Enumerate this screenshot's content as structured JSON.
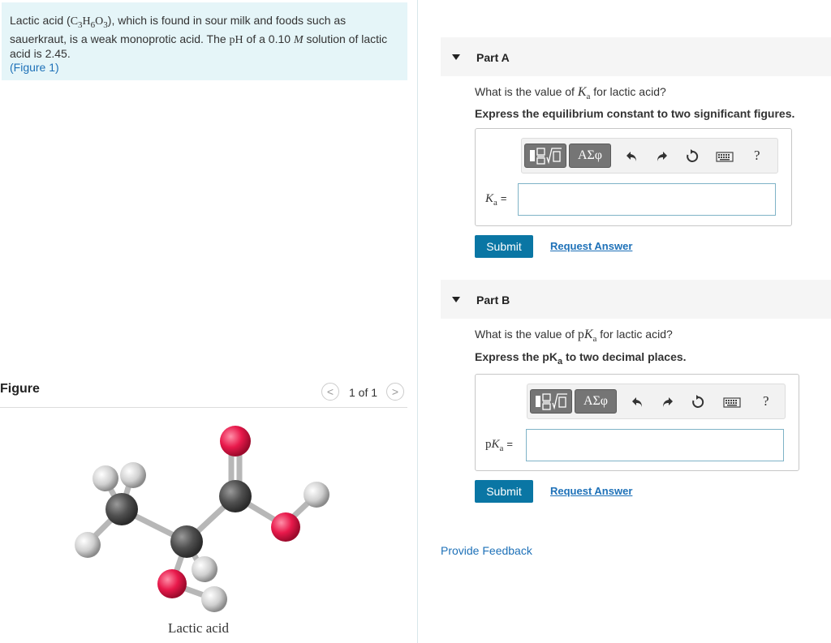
{
  "problem": {
    "text_1": "Lactic acid (",
    "formula_c": "C",
    "formula_c_sub": "3",
    "formula_h": "H",
    "formula_h_sub": "6",
    "formula_o": "O",
    "formula_o_sub": "3",
    "text_2": "), which is found in sour milk and foods such as sauerkraut, is a weak monoprotic acid. The ",
    "ph_symbol": "pH",
    "text_3": " of a 0.10 ",
    "molar_symbol": "M",
    "text_4": " solution of lactic acid is 2.45.",
    "figure_link": "(Figure 1)"
  },
  "figure": {
    "title": "Figure",
    "prev_icon": "chevron-left-icon",
    "prev_symbol": "<",
    "page_count": "1 of 1",
    "next_icon": "chevron-right-icon",
    "next_symbol": ">",
    "caption": "Lactic acid"
  },
  "partA": {
    "title": "Part A",
    "question_pre": "What is the value of ",
    "k_symbol": "K",
    "k_sub": "a",
    "question_post": " for lactic acid?",
    "instruction": "Express the equilibrium constant to two significant figures.",
    "label_k": "K",
    "label_sub": "a",
    "label_eq": "=",
    "input_value": "",
    "submit_label": "Submit",
    "request_label": "Request Answer"
  },
  "partB": {
    "title": "Part B",
    "question_pre": "What is the value of ",
    "pk_p": "p",
    "pk_k": "K",
    "pk_sub": "a",
    "question_post": " for lactic acid?",
    "instruction_pre": "Express the pK",
    "instruction_sub": "a",
    "instruction_post": " to two decimal places.",
    "label_p": "p",
    "label_k": "K",
    "label_sub": "a",
    "label_eq": "=",
    "input_value": "",
    "submit_label": "Submit",
    "request_label": "Request Answer"
  },
  "toolbar": {
    "greek_label": "ΑΣφ",
    "help_symbol": "?",
    "icons": [
      "template-icon",
      "greek-symbols-icon",
      "undo-icon",
      "redo-icon",
      "reset-icon",
      "keyboard-icon",
      "help-icon"
    ]
  },
  "feedback_label": "Provide Feedback",
  "colors": {
    "problem_bg": "#e5f5f8",
    "link": "#1e71b8",
    "submit": "#0a76a4",
    "oxygen": "#e8194b",
    "carbon": "#555555",
    "hydrogen": "#d8d8d8"
  }
}
